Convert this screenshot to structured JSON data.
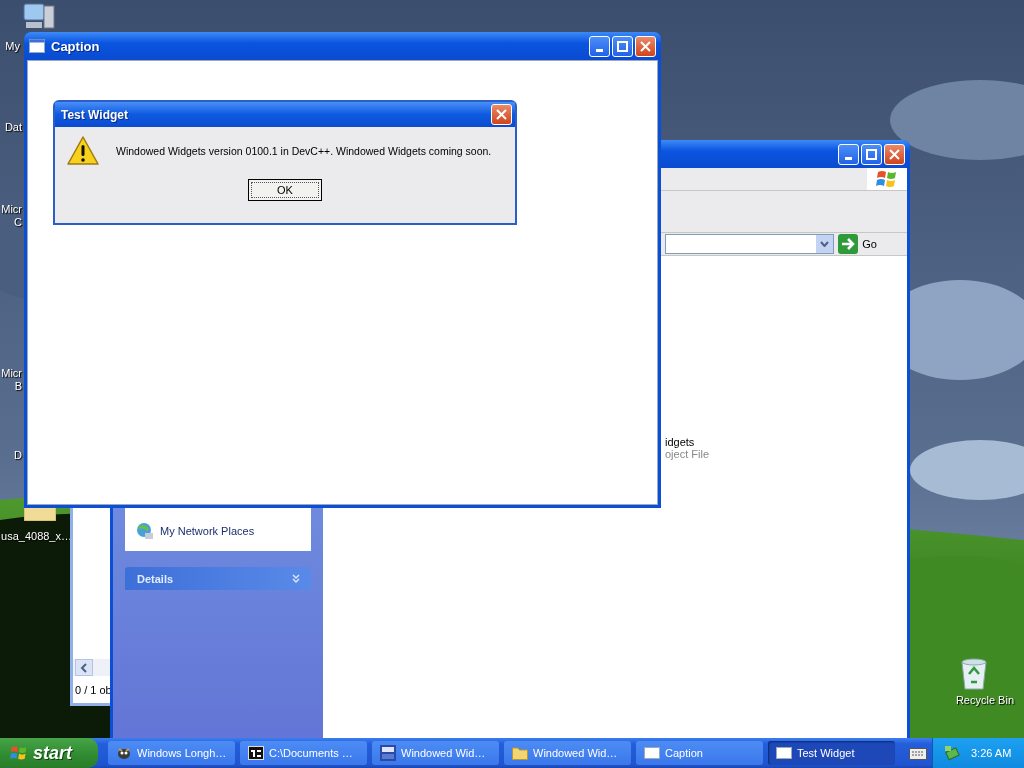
{
  "desktop": {
    "icons": [
      {
        "kind": "computer",
        "lines": [
          "My"
        ]
      },
      {
        "kind": "hidden",
        "lines": [
          "Dat"
        ]
      },
      {
        "kind": "hidden",
        "lines": [
          "Micr",
          "C"
        ]
      },
      {
        "kind": "hidden",
        "lines": [
          "Micr",
          "B"
        ]
      },
      {
        "kind": "hidden",
        "lines": [
          "D"
        ]
      },
      {
        "kind": "folder",
        "lines": [
          "usa_4088_x…"
        ]
      },
      {
        "kind": "recycle",
        "lines": [
          "Recycle Bin"
        ]
      }
    ]
  },
  "back_window": {
    "status": "0 / 1 ob"
  },
  "explorer": {
    "go_label": "Go",
    "task_pane": {
      "places": [
        "My Network Places"
      ],
      "details": {
        "title": "Details",
        "expanded": false
      }
    },
    "files": [
      {
        "name": "idgets",
        "type": "oject File"
      }
    ]
  },
  "caption_window": {
    "title": "Caption"
  },
  "dialog": {
    "title": "Test Widget",
    "message": "Windowed Widgets version 0100.1 in DevC++. Windowed Widgets coming soon.",
    "button": "OK"
  },
  "taskbar": {
    "start": "start",
    "tasks": [
      {
        "kind": "creature",
        "label": "Windows Longh…",
        "selected": false
      },
      {
        "kind": "archive",
        "label": "C:\\Documents …",
        "selected": false
      },
      {
        "kind": "ide",
        "label": "Windowed Wid…",
        "selected": false
      },
      {
        "kind": "folder",
        "label": "Windowed Wid…",
        "selected": false
      },
      {
        "kind": "window",
        "label": "Caption",
        "selected": false
      },
      {
        "kind": "window",
        "label": "Test Widget",
        "selected": true
      }
    ],
    "clock": "3:26 AM"
  }
}
